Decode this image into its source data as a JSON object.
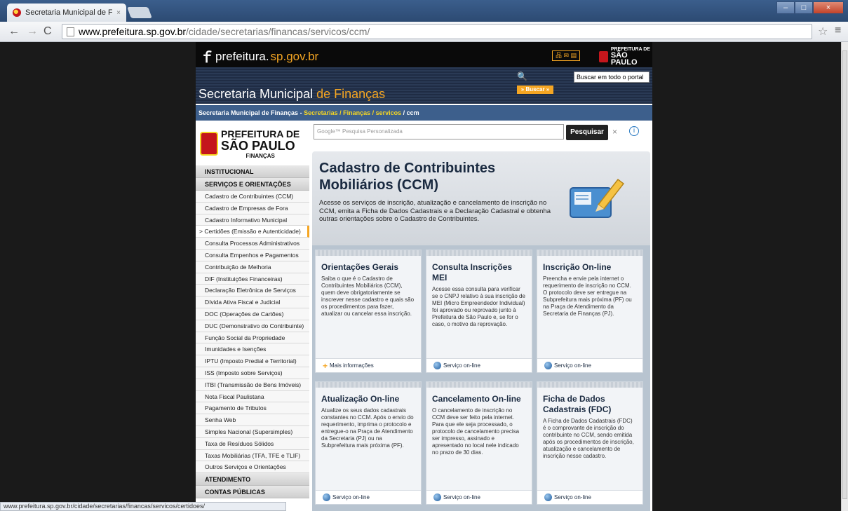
{
  "browser": {
    "tab_title": "Secretaria Municipal de Fin",
    "tab_close": "×",
    "url_host": "www.prefeitura.sp.gov.br",
    "url_path": "/cidade/secretarias/financas/servicos/ccm/",
    "status_url": "www.prefeitura.sp.gov.br/cidade/secretarias/financas/servicos/certidoes/"
  },
  "header": {
    "logo_main": "prefeitura.",
    "logo_accent": "sp.gov.br",
    "brand_small": "PREFEITURA DE",
    "brand_big": "SÃO PAULO",
    "icons_text": "品 ✉ ▤",
    "search_label": "Buscar em todo o portal",
    "search_button": "» Buscar »",
    "sec_name_main": "Secretaria Municipal",
    "sec_name_accent": "de Finanças"
  },
  "breadcrumb": {
    "root": "Secretaria Municipal de Finanças",
    "sep": " - ",
    "links": "Secretarias / Finanças / servicos",
    "current": " / ccm"
  },
  "sidebar": {
    "logo_line1": "PREFEITURA DE",
    "logo_line2": "SÃO PAULO",
    "logo_line3": "FINANÇAS",
    "sections": {
      "institucional": "INSTITUCIONAL",
      "servicos": "SERVIÇOS E ORIENTAÇÕES",
      "atendimento": "ATENDIMENTO",
      "contas": "CONTAS PÚBLICAS"
    },
    "items": [
      "Cadastro de Contribuintes (CCM)",
      "Cadastro de Empresas de Fora",
      "Cadastro Informativo Municipal",
      "> Certidões (Emissão e Autenticidade)",
      "Consulta Processos Administrativos",
      "Consulta Empenhos e Pagamentos",
      "Contribuição de Melhoria",
      "DIF (Instituições Financeiras)",
      "Declaração Eletrônica de Serviços",
      "Dívida Ativa Fiscal e Judicial",
      "DOC (Operações de Cartões)",
      "DUC (Demonstrativo do Contribuinte)",
      "Função Social da Propriedade",
      "Imunidades e Isenções",
      "IPTU (Imposto Predial e Territorial)",
      "ISS (Imposto sobre Serviços)",
      "ITBI (Transmissão de Bens Imóveis)",
      "Nota Fiscal Paulistana",
      "Pagamento de Tributos",
      "Senha Web",
      "Simples Nacional (Supersimples)",
      "Taxa de Resíduos Sólidos",
      "Taxas Mobiliárias (TFA, TFE e TLIF)",
      "Outros Serviços e Orientações"
    ]
  },
  "gsearch": {
    "placeholder": "Google™ Pesquisa Personalizada",
    "button": "Pesquisar",
    "clear": "×",
    "info": "i"
  },
  "hero": {
    "title": "Cadastro de Contribuintes Mobiliários (CCM)",
    "text": "Acesse os serviços de inscrição, atualização e cancelamento de inscrição no CCM, emita a Ficha de Dados Cadastrais e a Declaração Cadastral e obtenha outras orientações sobre o Cadastro de Contribuintes."
  },
  "cards": [
    {
      "title": "Orientações Gerais",
      "text": "Saiba o que é o Cadastro de Contribuintes Mobiliários (CCM), quem deve obrigatoriamente se inscrever nesse cadastro e quais são os procedimentos para fazer, atualizar ou cancelar essa inscrição.",
      "link": "Mais informações"
    },
    {
      "title": "Consulta Inscrições MEI",
      "text": "Acesse essa consulta para verificar se o CNPJ relativo à sua inscrição de MEI (Micro Empreendedor Individual) foi aprovado ou reprovado junto à Prefeitura de São Paulo e, se for o caso, o motivo da reprovação.",
      "link": "Serviço on-line"
    },
    {
      "title": "Inscrição On-line",
      "text": "Preencha e envie pela internet o requerimento de inscrição no CCM. O protocolo deve ser entregue na Subprefeitura mais próxima (PF) ou na Praça de Atendimento da Secretaria de Finanças (PJ).",
      "link": "Serviço on-line"
    },
    {
      "title": "Atualização On-line",
      "text": "Atualize os seus dados cadastrais constantes no CCM. Após o envio do requerimento, imprima o protocolo e entregue-o na Praça de Atendimento da Secretaria (PJ) ou na Subprefeitura mais próxima (PF).",
      "link": "Serviço on-line"
    },
    {
      "title": "Cancelamento On-line",
      "text": "O cancelamento de inscrição no CCM deve ser feito pela internet. Para que ele seja processado, o protocolo de cancelamento precisa ser impresso, assinado e apresentado no local nele indicado no prazo de 30 dias.",
      "link": "Serviço on-line"
    },
    {
      "title": "Ficha de Dados Cadastrais (FDC)",
      "text": "A Ficha de Dados Cadastrais (FDC) é o comprovante de inscrição do contribuinte no CCM, sendo emitida após os procedimentos de inscrição, atualização e cancelamento de inscrição nesse cadastro.",
      "link": "Serviço on-line"
    }
  ]
}
